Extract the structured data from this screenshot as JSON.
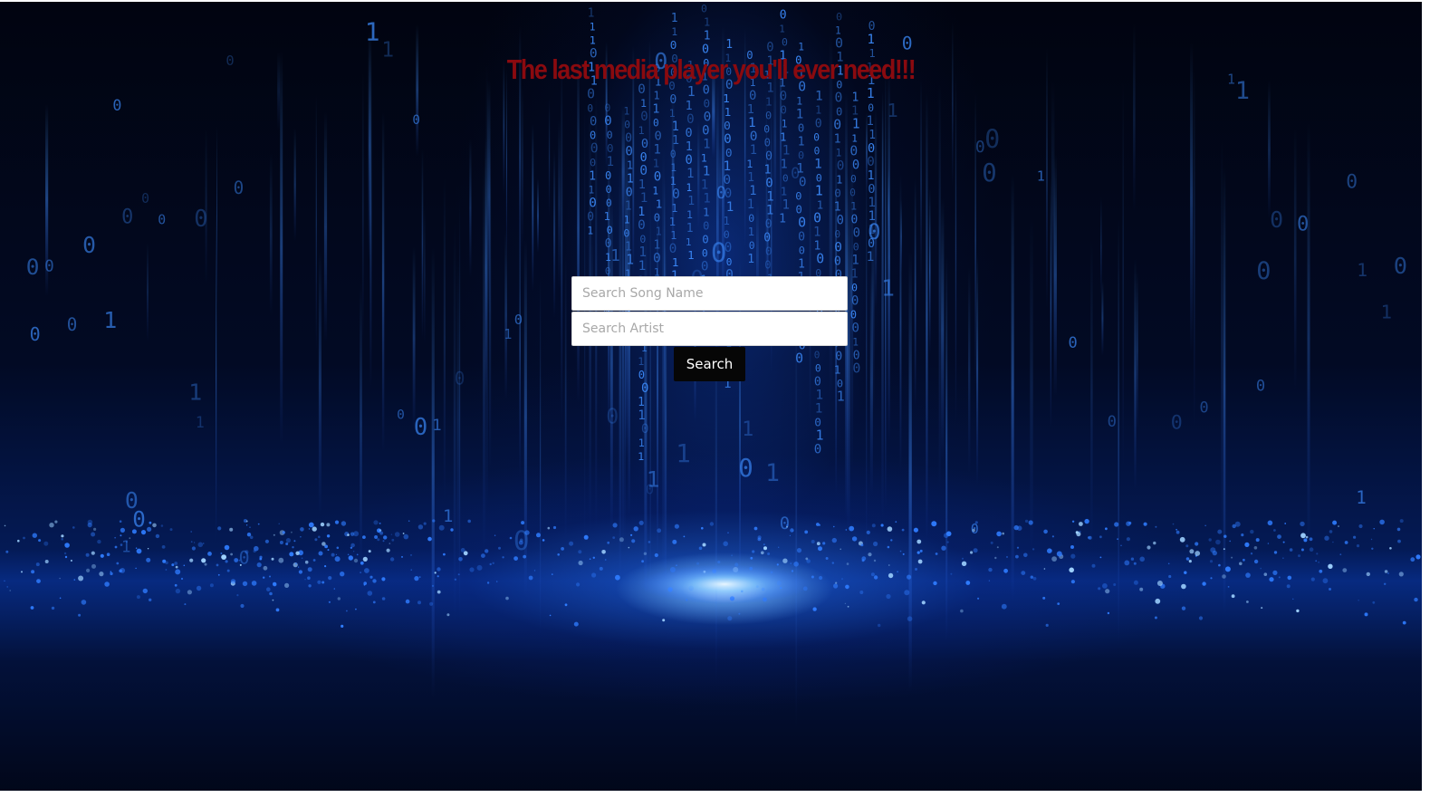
{
  "page": {
    "title": "The last media player you'll ever need!!!"
  },
  "search": {
    "song_placeholder": "Search Song Name",
    "artist_placeholder": "Search Artist",
    "button_label": "Search"
  },
  "colors": {
    "title": "#8a0a0f",
    "button_bg": "#060606",
    "button_text": "#ffffff",
    "background_accent": "#1f6bff"
  },
  "background": {
    "description_icon": "binary-rain-background"
  }
}
